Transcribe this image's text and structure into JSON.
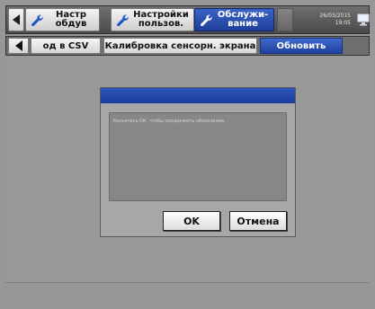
{
  "topbar": {
    "tabs": [
      {
        "label": "Настр\nобдув"
      },
      {
        "label": "Настройки\nпользов."
      },
      {
        "label": "Обслужи-\nвание"
      }
    ],
    "date": "26/03/2015",
    "time": "19:05"
  },
  "subbar": {
    "tabs": [
      {
        "label": "од в CSV"
      },
      {
        "label": "Калибровка сенсорн. экрана"
      },
      {
        "label": "Обновить"
      }
    ]
  },
  "dialog": {
    "message": "Коснитесь ОК, чтобы продолжить обновление.",
    "ok_label": "OK",
    "cancel_label": "Отмена"
  },
  "colors": {
    "accent": "#2a4fae",
    "background": "#979797"
  },
  "icons": {
    "tab_icon": "wrench-icon",
    "scroll_left": "arrow-left-icon",
    "scroll_right": "arrow-right-icon",
    "top_right": "monitor-icon"
  }
}
